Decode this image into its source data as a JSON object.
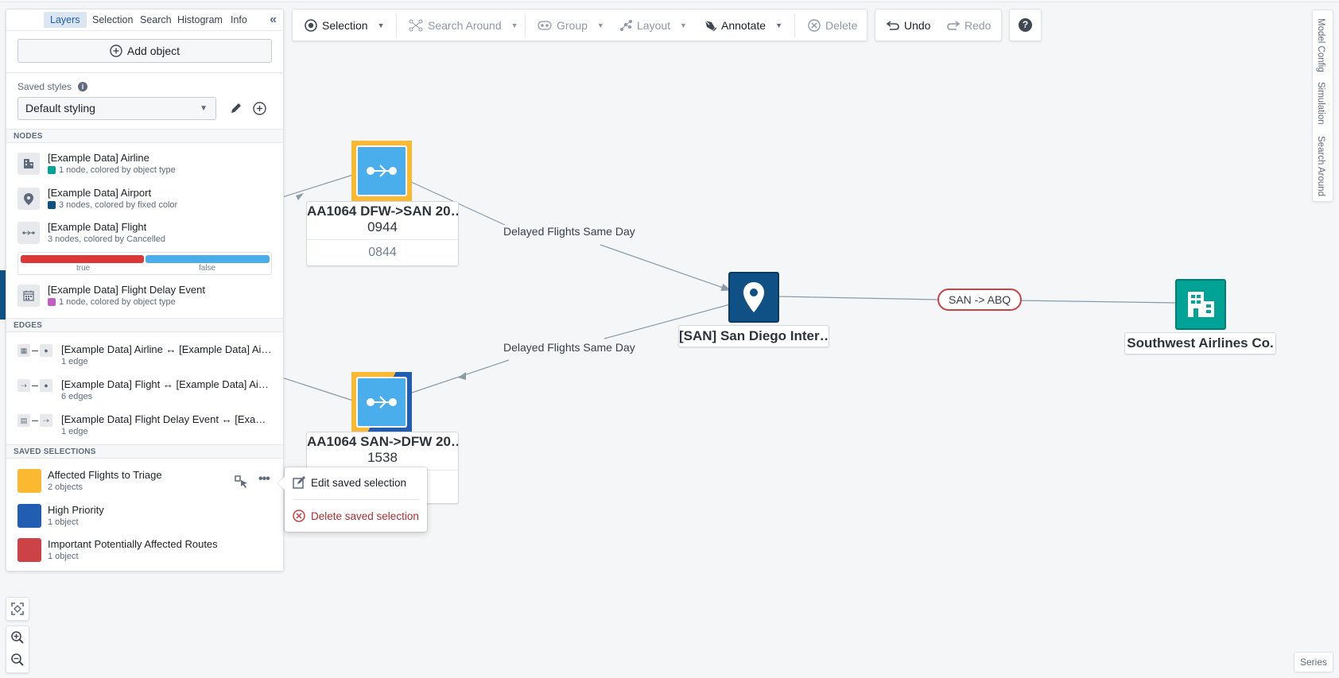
{
  "toolbar": {
    "selection": "Selection",
    "search_around": "Search Around",
    "group": "Group",
    "layout": "Layout",
    "annotate": "Annotate",
    "delete": "Delete",
    "undo": "Undo",
    "redo": "Redo",
    "help_icon": "?"
  },
  "right_tabs": [
    "Model Config",
    "Simulation",
    "Search Around"
  ],
  "series_button": "Series",
  "panel": {
    "tabs": [
      {
        "label": "Layers",
        "active": true
      },
      {
        "label": "Selection",
        "active": false
      },
      {
        "label": "Search",
        "active": false
      },
      {
        "label": "Histogram",
        "active": false
      },
      {
        "label": "Info",
        "active": false
      }
    ],
    "collapse_icon": "«",
    "add_object": "Add object",
    "saved_styles_label": "Saved styles",
    "saved_styles_value": "Default styling",
    "nodes_header": "NODES",
    "nodes": [
      {
        "icon": "building-icon",
        "title": "[Example Data] Airline",
        "sub": "1 node, colored by object type",
        "color": "#00a396"
      },
      {
        "icon": "map-marker-icon",
        "title": "[Example Data] Airport",
        "sub": "3 nodes, colored by fixed color",
        "color": "#0f5185"
      },
      {
        "icon": "flight-icon",
        "title": "[Example Data] Flight",
        "sub": "3 nodes, colored by Cancelled",
        "color": null
      },
      {
        "icon": "calendar-icon",
        "title": "[Example Data] Flight Delay Event",
        "sub": "1 node, colored by object type",
        "color": "#c15ec2"
      }
    ],
    "flight_legend": [
      {
        "label": "true",
        "color": "#dc3838"
      },
      {
        "label": "false",
        "color": "#4aadec"
      }
    ],
    "edges_header": "EDGES",
    "edges": [
      {
        "title": "[Example Data] Airline ↔ [Example Data] Airport",
        "sub": "1 edge"
      },
      {
        "title": "[Example Data] Flight ↔ [Example Data] Airport",
        "sub": "6 edges"
      },
      {
        "title": "[Example Data] Flight Delay Event ↔ [Example Data] Flight",
        "sub": "1 edge"
      }
    ],
    "selections_header": "SAVED SELECTIONS",
    "selections": [
      {
        "title": "Affected Flights to Triage",
        "sub": "2 objects",
        "color": "#fbb931"
      },
      {
        "title": "High Priority",
        "sub": "1 object",
        "color": "#215db0"
      },
      {
        "title": "Important Potentially Affected Routes",
        "sub": "1 object",
        "color": "#cd4246"
      }
    ]
  },
  "popover": {
    "edit": "Edit saved selection",
    "delete": "Delete saved selection"
  },
  "graph": {
    "edge_labels": [
      "Delayed Flights Same Day",
      "Delayed Flights Same Day"
    ],
    "route_pill": "SAN -> ABQ",
    "nodes": {
      "flight_1": {
        "title": "AA1064 DFW->SAN 20…",
        "line2": "0944",
        "prop": "0844"
      },
      "flight_2": {
        "title": "AA1064 SAN->DFW 20…",
        "line2": "1538"
      },
      "airport": {
        "title": "[SAN] San Diego Inter…"
      },
      "airline": {
        "title": "Southwest Airlines Co."
      }
    }
  },
  "colors": {
    "flight_fill": "#4aadec",
    "airport_fill": "#0f5185",
    "airline_fill": "#00a396",
    "sel_yellow": "#fbb931",
    "sel_blue": "#215db0",
    "sel_red": "#cd4246"
  }
}
